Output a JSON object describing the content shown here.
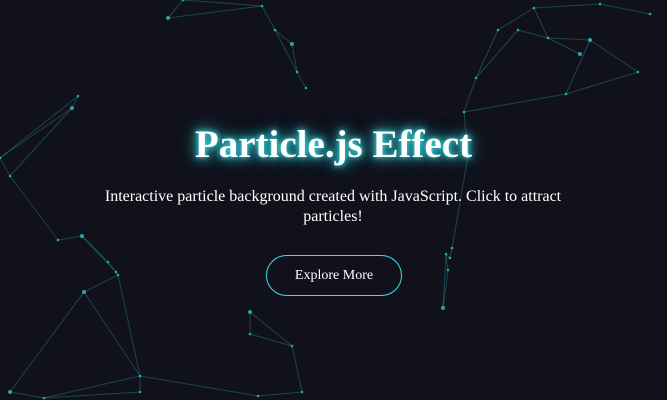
{
  "hero": {
    "title": "Particle.js Effect",
    "subtitle": "Interactive particle background created with JavaScript. Click to attract particles!",
    "button_label": "Explore More"
  },
  "colors": {
    "background": "#11111b",
    "accent": "#2ecfd6",
    "text": "#ffffff"
  }
}
